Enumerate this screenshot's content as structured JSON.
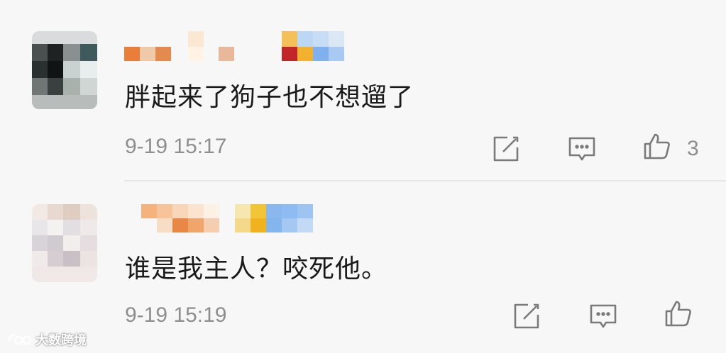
{
  "comments": [
    {
      "text": "胖起来了狗子也不想遛了",
      "time": "9-19 15:17",
      "like_count": "3",
      "actions": [
        "edit-icon",
        "comment-icon",
        "like-icon"
      ]
    },
    {
      "text": "谁是我主人？咬死他。",
      "time": "9-19 15:19",
      "like_count": "",
      "actions": [
        "edit-icon",
        "comment-icon",
        "like-icon"
      ]
    }
  ],
  "watermark": {
    "text": "大数跨境"
  },
  "colors": {
    "background": "#f7f7f7",
    "text": "#1a1a1a",
    "meta": "#8e8e8e",
    "icon": "#7a7a7a"
  }
}
